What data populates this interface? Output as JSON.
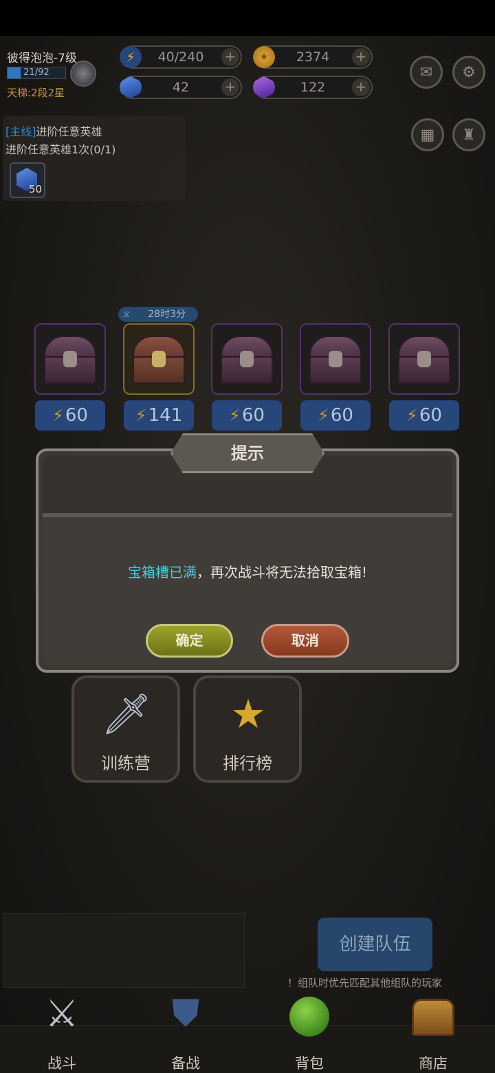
{
  "player": {
    "name": "彼得泡泡-7级",
    "xp_text": "21/92",
    "xp_fraction": 0.23,
    "ladder": "天梯:2段2星"
  },
  "resources": {
    "stamina": {
      "value": "40/240",
      "icon": "lightning-icon"
    },
    "gold": {
      "value": "2374",
      "icon": "gold-coin-icon"
    },
    "blue_gem": {
      "value": "42",
      "icon": "blue-gem-icon"
    },
    "purple_gem": {
      "value": "122",
      "icon": "purple-gem-icon"
    },
    "plus_label": "+"
  },
  "quest": {
    "tag": "[主线]",
    "title": "进阶任意英雄",
    "desc": "进阶任意英雄1次(0/1)",
    "reward_count": "50"
  },
  "chests": {
    "timer": "28时3分",
    "slots": [
      {
        "cost": "60"
      },
      {
        "cost": "141"
      },
      {
        "cost": "60"
      },
      {
        "cost": "60"
      },
      {
        "cost": "60"
      }
    ]
  },
  "dialog": {
    "title": "提示",
    "message_highlight": "宝箱槽已满",
    "message_rest": "，再次战斗将无法拾取宝箱!",
    "ok_label": "确定",
    "cancel_label": "取消"
  },
  "tiles": {
    "training": "训练营",
    "ranking": "排行榜"
  },
  "team": {
    "create_label": "创建队伍",
    "hint": "！组队时优先匹配其他组队的玩家"
  },
  "nav": {
    "battle": "战斗",
    "prepare": "备战",
    "bag": "背包",
    "shop": "商店"
  },
  "colors": {
    "accent_blue": "#2a8fd6",
    "highlight_cyan": "#3cd2e6",
    "ok_green": "#9ea42a",
    "cancel_orange": "#b2593a",
    "ladder_gold": "#c8912e"
  }
}
